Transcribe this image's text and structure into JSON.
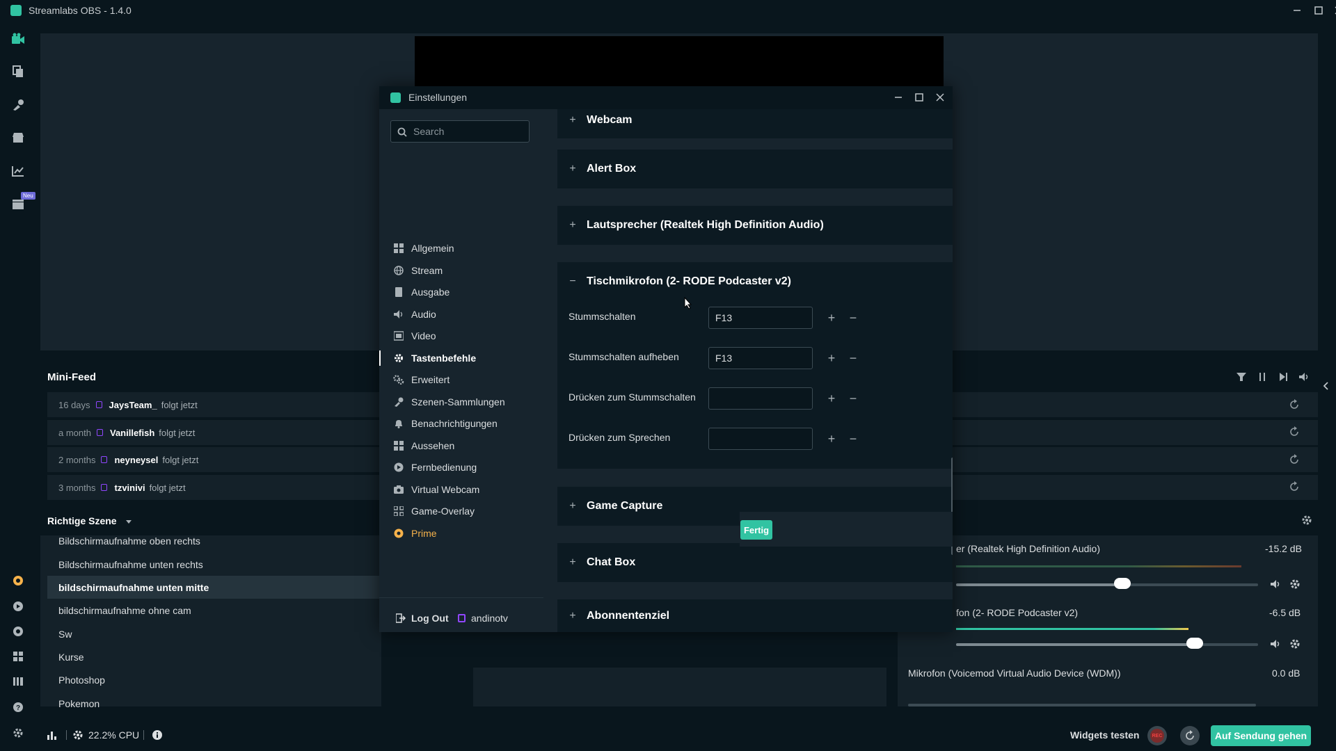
{
  "app": {
    "title": "Streamlabs OBS - 1.4.0"
  },
  "leftnav": {
    "neu_badge": "Neu",
    "icons": [
      "studio-icon",
      "themes-icon",
      "editor-icon",
      "store-icon",
      "dashboard-icon",
      "highlighter-icon"
    ]
  },
  "minifeed": {
    "title": "Mini-Feed",
    "items": [
      {
        "time": "16 days",
        "user": "JaysTeam_",
        "action": "folgt jetzt"
      },
      {
        "time": "a month",
        "user": "Vanillefish",
        "action": "folgt jetzt"
      },
      {
        "time": "2 months",
        "user": "neyneysel",
        "action": "folgt jetzt"
      },
      {
        "time": "3 months",
        "user": "tzvinivi",
        "action": "folgt jetzt"
      }
    ]
  },
  "scenes": {
    "header": "Richtige Szene",
    "items": [
      "Bildschirmaufnahme oben rechts",
      "Bildschirmaufnahme unten rechts",
      "bildschirmaufnahme unten mitte",
      "bildschirmaufnahme ohne cam",
      "Sw",
      "Kurse",
      "Photoshop",
      "Pokemon"
    ],
    "active_index": 2
  },
  "mixer": {
    "items": [
      {
        "label": "er (Realtek High Definition Audio)",
        "db": "-15.2 dB",
        "level": 0.55
      },
      {
        "label": "fon (2- RODE Podcaster v2)",
        "db": "-6.5 dB",
        "level": 0.79
      },
      {
        "label": "Mikrofon (Voicemod Virtual Audio Device (WDM))",
        "db": "0.0 dB",
        "level": 1.0
      }
    ]
  },
  "statusbar": {
    "cpu": "22.2% CPU",
    "widgets_test": "Widgets testen",
    "rec_label": "REC",
    "go_live": "Auf Sendung gehen"
  },
  "settings": {
    "title": "Einstellungen",
    "search_placeholder": "Search",
    "nav": [
      {
        "label": "Allgemein",
        "icon": "grid-icon"
      },
      {
        "label": "Stream",
        "icon": "globe-icon"
      },
      {
        "label": "Ausgabe",
        "icon": "output-icon"
      },
      {
        "label": "Audio",
        "icon": "speaker-icon"
      },
      {
        "label": "Video",
        "icon": "film-icon"
      },
      {
        "label": "Tastenbefehle",
        "icon": "gear-icon"
      },
      {
        "label": "Erweitert",
        "icon": "advanced-gear-icon"
      },
      {
        "label": "Szenen-Sammlungen",
        "icon": "collection-icon"
      },
      {
        "label": "Benachrichtigungen",
        "icon": "bell-icon"
      },
      {
        "label": "Aussehen",
        "icon": "appearance-icon"
      },
      {
        "label": "Fernbedienung",
        "icon": "remote-icon"
      },
      {
        "label": "Virtual Webcam",
        "icon": "camera-icon"
      },
      {
        "label": "Game-Overlay",
        "icon": "overlay-icon"
      },
      {
        "label": "Prime",
        "icon": "prime-icon"
      }
    ],
    "active_nav": "Tastenbefehle",
    "logout": "Log Out",
    "account": "andinotv",
    "sections": [
      {
        "title": "Webcam",
        "expanded": false
      },
      {
        "title": "Alert Box",
        "expanded": false
      },
      {
        "title": "Lautsprecher (Realtek High Definition Audio)",
        "expanded": false
      },
      {
        "title": "Tischmikrofon (2- RODE Podcaster v2)",
        "expanded": true
      },
      {
        "title": "Game Capture",
        "expanded": false
      },
      {
        "title": "Chat Box",
        "expanded": false
      },
      {
        "title": "Abonnentenziel",
        "expanded": false
      }
    ],
    "hotkeys": [
      {
        "label": "Stummschalten",
        "value": "F13"
      },
      {
        "label": "Stummschalten aufheben",
        "value": "F13"
      },
      {
        "label": "Drücken zum Stummschalten",
        "value": ""
      },
      {
        "label": "Drücken zum Sprechen",
        "value": ""
      }
    ],
    "done_button": "Fertig"
  }
}
